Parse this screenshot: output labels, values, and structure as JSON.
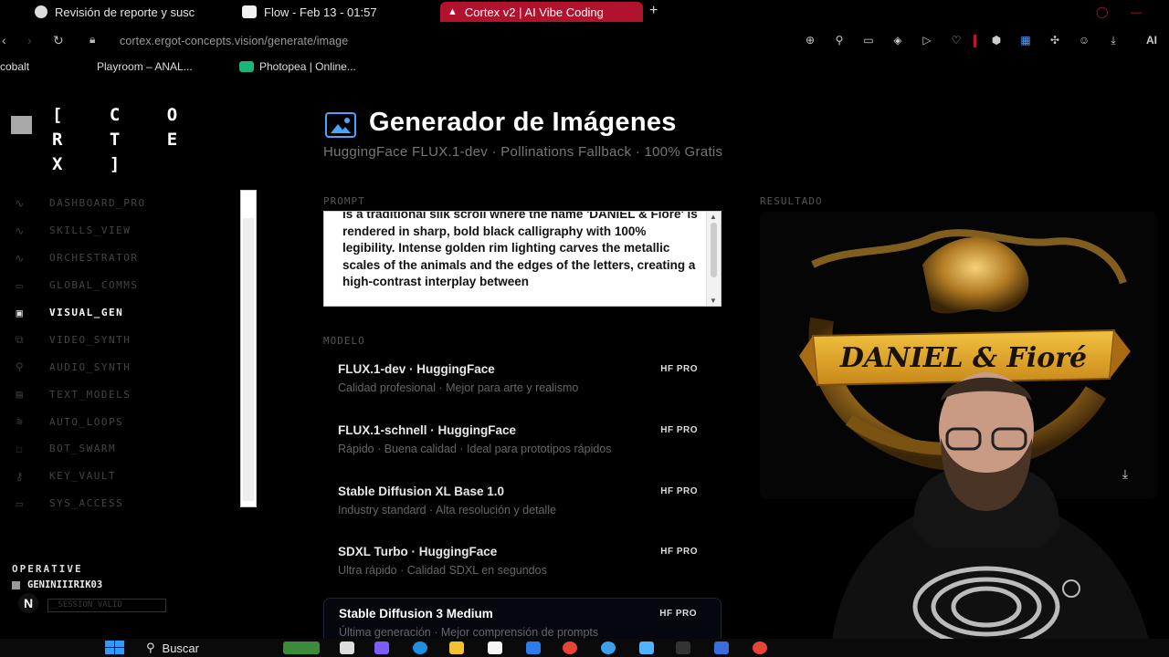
{
  "browser": {
    "tabs": [
      {
        "label": "Revisión de reporte y susc",
        "active": false
      },
      {
        "label": "Flow - Feb 13 - 01:57",
        "active": false
      },
      {
        "label": "Cortex v2 | AI Vibe Coding",
        "active": true
      }
    ],
    "new_tab": "+",
    "url": "cortex.ergot-concepts.vision/generate/image",
    "bookmarks": [
      "cobalt",
      "Playroom – ANAL...",
      "Photopea | Online..."
    ],
    "profile_label": "AI"
  },
  "sidebar": {
    "logo": "[ C O R T E X ]",
    "items": [
      {
        "label": "DASHBOARD_PRO",
        "icon": "pulse-icon",
        "glyph": "∿"
      },
      {
        "label": "SKILLS_VIEW",
        "icon": "pulse-icon",
        "glyph": "∿"
      },
      {
        "label": "ORCHESTRATOR",
        "icon": "pulse-icon",
        "glyph": "∿"
      },
      {
        "label": "GLOBAL_COMMS",
        "icon": "chat-icon",
        "glyph": "▭"
      },
      {
        "label": "VISUAL_GEN",
        "icon": "image-icon",
        "glyph": "▣",
        "active": true
      },
      {
        "label": "VIDEO_SYNTH",
        "icon": "video-icon",
        "glyph": "⧉"
      },
      {
        "label": "AUDIO_SYNTH",
        "icon": "mic-icon",
        "glyph": "⚲"
      },
      {
        "label": "TEXT_MODELS",
        "icon": "document-icon",
        "glyph": "▤"
      },
      {
        "label": "AUTO_LOOPS",
        "icon": "layers-icon",
        "glyph": "≋"
      },
      {
        "label": "BOT_SWARM",
        "icon": "bot-icon",
        "glyph": "☐"
      },
      {
        "label": "KEY_VAULT",
        "icon": "key-icon",
        "glyph": "⚷"
      },
      {
        "label": "SYS_ACCESS",
        "icon": "server-icon",
        "glyph": "▭"
      }
    ],
    "operative_label": "OPERATIVE",
    "user": "GENINIIIRIK03",
    "session": "_SESSION_VALID"
  },
  "main": {
    "title": "Generador de Imágenes",
    "subtitle": "HuggingFace FLUX.1-dev · Pollinations Fallback · 100% Gratis",
    "prompt_label": "PROMPT",
    "prompt_text": "is a traditional silk scroll where the name 'DANIEL & Fiore' is rendered in sharp, bold black calligraphy with 100% legibility. Intense golden rim lighting carves the metallic scales of the animals and the edges of the letters, creating a high-contrast interplay between",
    "model_label": "MODELO",
    "models": [
      {
        "name": "FLUX.1-dev · HuggingFace",
        "desc": "Calidad profesional · Mejor para arte y realismo",
        "badge": "HF PRO"
      },
      {
        "name": "FLUX.1-schnell · HuggingFace",
        "desc": "Rápido · Buena calidad · Ideal para prototipos rápidos",
        "badge": "HF PRO"
      },
      {
        "name": "Stable Diffusion XL Base 1.0",
        "desc": "Industry standard · Alta resolución y detalle",
        "badge": "HF PRO"
      },
      {
        "name": "SDXL Turbo · HuggingFace",
        "desc": "Ultra rápido · Calidad SDXL en segundos",
        "badge": "HF PRO"
      },
      {
        "name": "Stable Diffusion 3 Medium",
        "desc": "Última generación · Mejor comprensión de prompts",
        "badge": "HF PRO",
        "selected": true
      }
    ],
    "result_label": "RESULTADO",
    "result_banner_text": "DANIEL & Fioré"
  },
  "taskbar": {
    "search_label": "Buscar"
  },
  "colors": {
    "accent": "#4aa3ff",
    "active_tab": "#b1132f",
    "background": "#000000"
  }
}
